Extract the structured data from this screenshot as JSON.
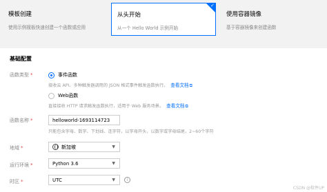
{
  "cards": [
    {
      "title": "模板创建",
      "desc": "使用示例模板快速创建一个函数或应用",
      "active": false
    },
    {
      "title": "从头开始",
      "desc": "从一个 Hello World 示例开始",
      "active": true
    },
    {
      "title": "使用容器镜像",
      "desc": "基于容器镜像来创建函数",
      "active": false
    }
  ],
  "basic": {
    "section_title": "基础配置",
    "function_type": {
      "label": "函数类型",
      "options": [
        {
          "label": "事件函数",
          "hint": "接收云 API、多种触发器调用的 JSON 格式事件触发函数执行。",
          "link": "查看文档",
          "checked": true
        },
        {
          "label": "Web函数",
          "hint": "直接接收 HTTP 请求触发函数执行，适用于 Web 服务场景。",
          "link": "查看文档",
          "checked": false
        }
      ]
    },
    "function_name": {
      "label": "函数名称",
      "value": "helloworld-1693114723",
      "hint": "只能包含字母、数字、下划线、连字符，以字母开头，以数字或字母结尾，2~60个字符"
    },
    "region": {
      "label": "地域",
      "value": "新加坡"
    },
    "runtime": {
      "label": "运行环境",
      "value": "Python 3.6"
    },
    "timezone": {
      "label": "时区",
      "value": "UTC"
    }
  },
  "watermark": "CSDN @软件UP"
}
